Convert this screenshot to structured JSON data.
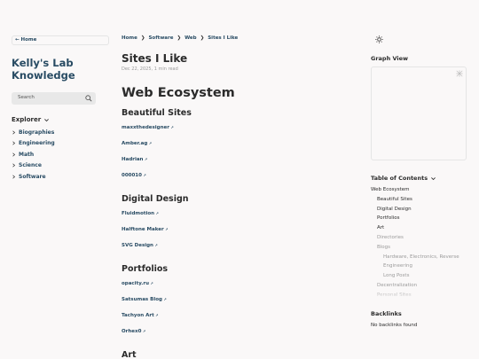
{
  "sidebar": {
    "home_label": "← Home",
    "site_title_line1": "Kelly's Lab",
    "site_title_line2": "Knowledge",
    "search_placeholder": "Search",
    "explorer_label": "Explorer",
    "folders": [
      "Biographies",
      "Engineering",
      "Math",
      "Science",
      "Software"
    ]
  },
  "breadcrumb": [
    "Home",
    "Software",
    "Web",
    "Sites I Like"
  ],
  "breadcrumb_sep": "❯",
  "page": {
    "title": "Sites I Like",
    "meta": "Dec 22, 2025, 1 min read",
    "h1": "Web Ecosystem",
    "sections": [
      {
        "heading": "Beautiful Sites",
        "links": [
          "maxxthedesigner",
          "Amber.ag",
          "Hadrian",
          "000010"
        ]
      },
      {
        "heading": "Digital Design",
        "links": [
          "Fluidmotion",
          "Halftone Maker",
          "SVG Design"
        ]
      },
      {
        "heading": "Portfolios",
        "links": [
          "opacity.ru",
          "Satsumas Blog",
          "Tachyon Art",
          "Orhex0"
        ]
      },
      {
        "heading": "Art",
        "links": []
      }
    ]
  },
  "right": {
    "graph_label": "Graph View",
    "toc_label": "Table of Contents",
    "toc": [
      {
        "text": "Web Ecosystem",
        "level": 0,
        "dim": false
      },
      {
        "text": "Beautiful Sites",
        "level": 1,
        "dim": false
      },
      {
        "text": "Digital Design",
        "level": 1,
        "dim": false
      },
      {
        "text": "Portfolios",
        "level": 1,
        "dim": false
      },
      {
        "text": "Art",
        "level": 1,
        "dim": false
      },
      {
        "text": "Directories",
        "level": 1,
        "dim": true
      },
      {
        "text": "Blogs",
        "level": 1,
        "dim": true
      },
      {
        "text": "Hardware, Electronics, Reverse",
        "level": 2,
        "dim": true
      },
      {
        "text": "Engineering",
        "level": 2,
        "dim": true
      },
      {
        "text": "Long Posts",
        "level": 2,
        "dim": true
      },
      {
        "text": "Decentralization",
        "level": 1,
        "dim": true
      },
      {
        "text": "Personal Sites",
        "level": 1,
        "dim": true
      }
    ],
    "backlinks_label": "Backlinks",
    "backlinks_empty": "No backlinks found"
  },
  "colors": {
    "accent": "#284b63",
    "text": "#2b2b2b",
    "muted": "#9a9a9a",
    "background": "#faf8f8"
  },
  "icons": {
    "search": "search-icon",
    "theme": "sun-icon",
    "graph": "graph-expand-icon",
    "external": "external-link-icon"
  }
}
